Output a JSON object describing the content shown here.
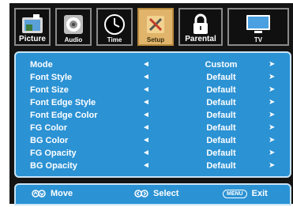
{
  "tabs": [
    {
      "label": "Picture",
      "icon": "tv-picture-icon",
      "selected": false
    },
    {
      "label": "Audio",
      "icon": "speaker-icon",
      "selected": false
    },
    {
      "label": "Time",
      "icon": "clock-icon",
      "selected": false
    },
    {
      "label": "Setup",
      "icon": "tools-icon",
      "selected": true
    },
    {
      "label": "Parental",
      "icon": "lock-icon",
      "selected": false
    },
    {
      "label": "TV",
      "icon": "monitor-icon",
      "selected": false
    }
  ],
  "rows": [
    {
      "name": "Mode",
      "value": "Custom"
    },
    {
      "name": "Font Style",
      "value": "Default"
    },
    {
      "name": "Font Size",
      "value": "Default"
    },
    {
      "name": "Font Edge Style",
      "value": "Default"
    },
    {
      "name": "Font Edge Color",
      "value": "Default"
    },
    {
      "name": "FG Color",
      "value": "Default"
    },
    {
      "name": "BG Color",
      "value": "Default"
    },
    {
      "name": "FG Opacity",
      "value": "Default"
    },
    {
      "name": "BG Opacity",
      "value": "Default"
    }
  ],
  "arrows": {
    "left": "◄",
    "right": "➤"
  },
  "footer": {
    "move": "Move",
    "select": "Select",
    "menu_key": "MENU",
    "exit": "Exit"
  },
  "colors": {
    "panel": "#2b92d4",
    "panel_border": "#c8e4f7",
    "selected_tab": "#e0b46a",
    "background": "#141414"
  }
}
